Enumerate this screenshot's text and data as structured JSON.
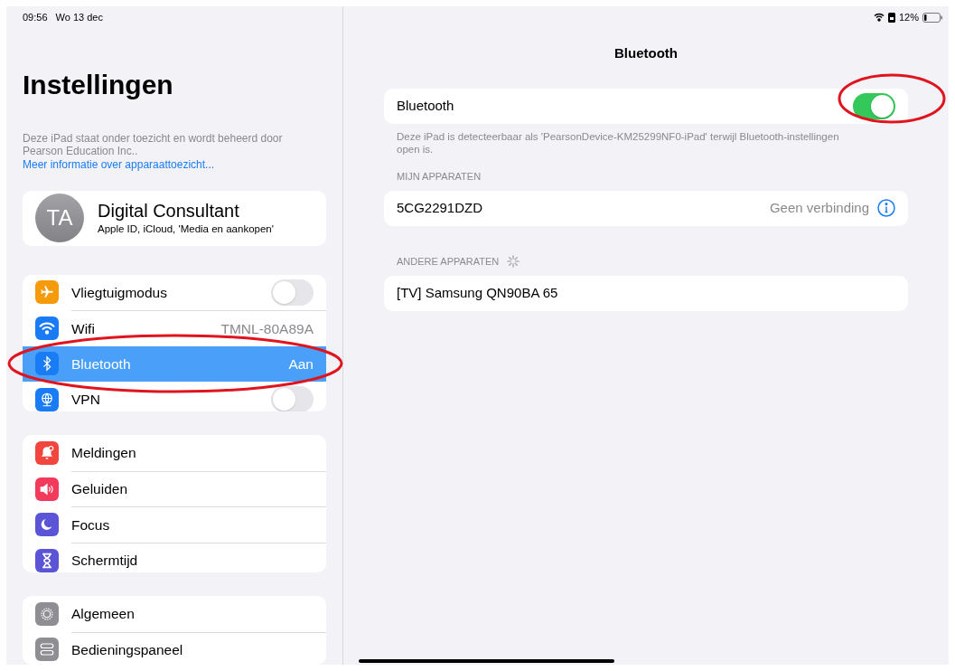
{
  "status_bar": {
    "time": "09:56",
    "date": "Wo 13 dec",
    "battery": "12%"
  },
  "sidebar": {
    "title": "Instellingen",
    "notice": "Deze iPad staat onder toezicht en wordt beheerd door Pearson Education Inc..",
    "notice_link": "Meer informatie over apparaattoezicht...",
    "profile": {
      "initials": "TA",
      "name": "Digital Consultant",
      "subtitle": "Apple ID, iCloud, 'Media en aankopen'"
    },
    "groups": [
      [
        {
          "label": "Vliegtuigmodus",
          "kind": "toggle",
          "on": false,
          "selected": false,
          "color": "#f59a0a"
        },
        {
          "label": "Wifi",
          "kind": "value",
          "value": "TMNL-80A89A",
          "selected": false,
          "color": "#1a7cf5"
        },
        {
          "label": "Bluetooth",
          "kind": "value",
          "value": "Aan",
          "selected": true,
          "color": "#1a7cf5"
        },
        {
          "label": "VPN",
          "kind": "toggle",
          "on": false,
          "selected": false,
          "color": "#1a7cf5"
        }
      ],
      [
        {
          "label": "Meldingen",
          "kind": "plain",
          "selected": false,
          "color": "#f2453d"
        },
        {
          "label": "Geluiden",
          "kind": "plain",
          "selected": false,
          "color": "#f23a5c"
        },
        {
          "label": "Focus",
          "kind": "plain",
          "selected": false,
          "color": "#5b54d6"
        },
        {
          "label": "Schermtijd",
          "kind": "plain",
          "selected": false,
          "color": "#5b54d6"
        }
      ],
      [
        {
          "label": "Algemeen",
          "kind": "plain",
          "selected": false,
          "color": "#8e8e93"
        },
        {
          "label": "Bedieningspaneel",
          "kind": "plain",
          "selected": false,
          "color": "#8e8e93"
        }
      ]
    ]
  },
  "detail": {
    "title": "Bluetooth",
    "toggle": {
      "label": "Bluetooth",
      "on": true
    },
    "footnote": "Deze iPad is detecteerbaar als 'PearsonDevice-KM25299NF0-iPad' terwijl Bluetooth-instellingen open is.",
    "my_devices": {
      "header": "MIJN APPARATEN",
      "items": [
        {
          "name": "5CG2291DZD",
          "status": "Geen verbinding"
        }
      ]
    },
    "other_devices": {
      "header": "ANDERE APPARATEN",
      "searching": true,
      "items": [
        {
          "name": "[TV] Samsung QN90BA 65"
        }
      ]
    }
  }
}
